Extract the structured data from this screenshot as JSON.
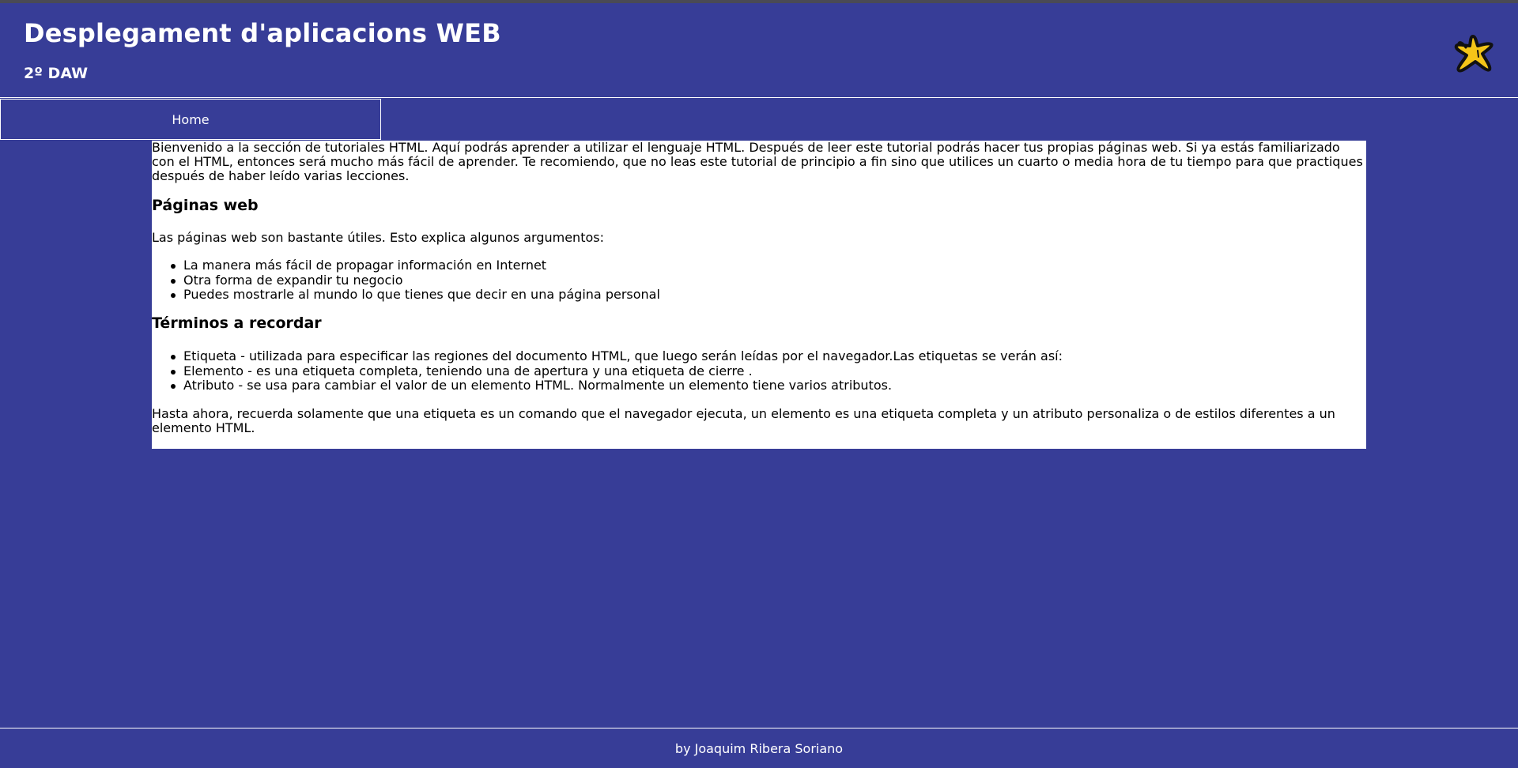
{
  "header": {
    "title": "Desplegament d'aplicacions WEB",
    "subtitle": "2º DAW",
    "logo_icon": "yellow-star-icon"
  },
  "nav": {
    "items": [
      {
        "label": "Home"
      }
    ]
  },
  "content": {
    "intro": "Bienvenido a la sección de tutoriales HTML. Aquí podrás aprender a utilizar el lenguaje HTML. Después de leer este tutorial podrás hacer tus propias páginas web. Si ya estás familiarizado con el HTML, entonces será mucho más fácil de aprender. Te recomiendo, que no leas este tutorial de principio a fin sino que utilices un cuarto o media hora de tu tiempo para que practiques después de haber leído varias lecciones.",
    "section_web": {
      "heading": "Páginas web",
      "paragraph": "Las páginas web son bastante útiles. Esto explica algunos argumentos:",
      "items": [
        "La manera más fácil de propagar información en Internet",
        "Otra forma de expandir tu negocio",
        "Puedes mostrarle al mundo lo que tienes que decir en una página personal"
      ]
    },
    "section_terms": {
      "heading": "Términos a recordar",
      "items": [
        "Etiqueta - utilizada para especificar las regiones del documento HTML, que luego serán leídas por el navegador.Las etiquetas se verán así:",
        "Elemento - es una etiqueta completa, teniendo una de apertura y una etiqueta de cierre .",
        "Atributo - se usa para cambiar el valor de un elemento HTML. Normalmente un elemento tiene varios atributos."
      ]
    },
    "outro": "Hasta ahora, recuerda solamente que una etiqueta es un comando que el navegador ejecuta, un elemento es una etiqueta completa y un atributo personaliza o de estilos diferentes a un elemento HTML."
  },
  "footer": {
    "credit": "by Joaquim Ribera Soriano"
  },
  "colors": {
    "background": "#373d97",
    "content_background": "#ffffff",
    "text_light": "#ffffff",
    "logo_fill": "#f5c518"
  }
}
